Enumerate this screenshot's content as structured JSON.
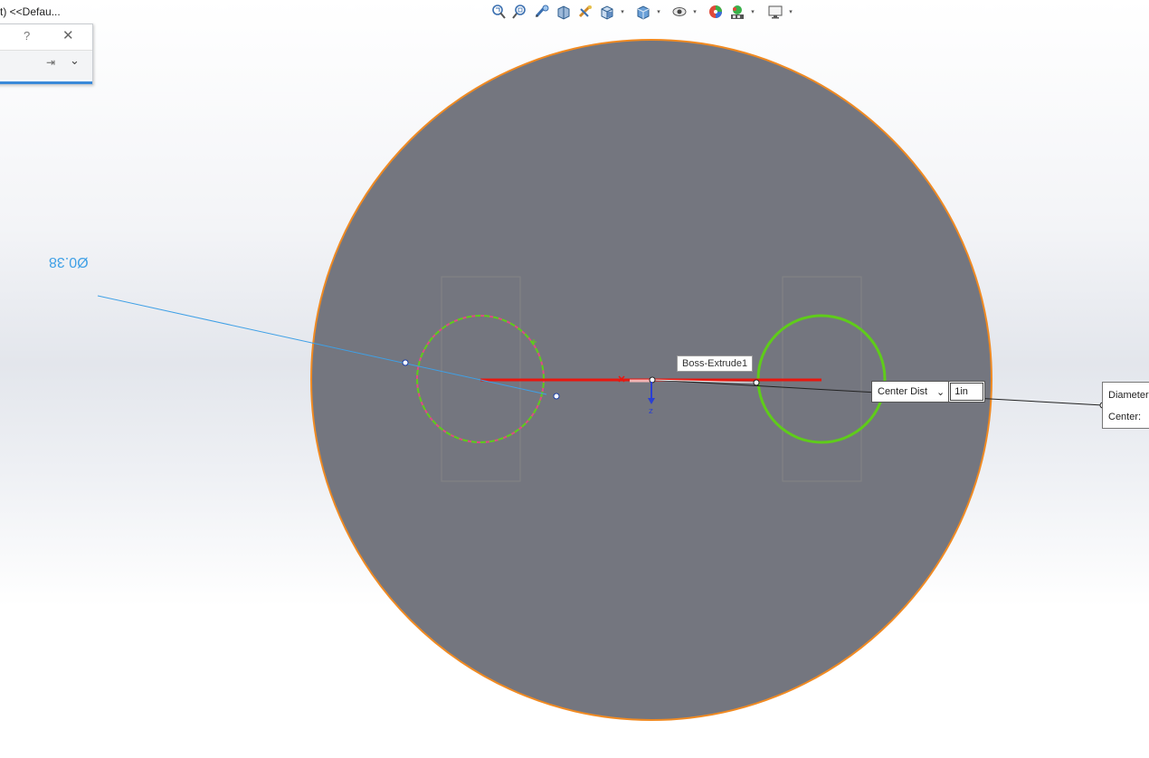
{
  "window": {
    "title_fragment": "t) <<Defau..."
  },
  "panel": {
    "help_label": "?",
    "close_label": "✕",
    "pin_label": "⇥",
    "expand_label": "⌄"
  },
  "toolbar": {
    "items": [
      {
        "icon": "zoom-to-fit-icon"
      },
      {
        "icon": "zoom-to-area-icon"
      },
      {
        "icon": "previous-view-icon"
      },
      {
        "icon": "section-view-icon"
      },
      {
        "icon": "dynamic-annotation-icon"
      },
      {
        "icon": "view-orientation-icon",
        "dropdown": true
      },
      {
        "icon": "display-style-icon",
        "dropdown": true
      },
      {
        "icon": "hide-show-items-icon",
        "dropdown": true
      },
      {
        "icon": "edit-appearance-icon"
      },
      {
        "icon": "apply-scene-icon",
        "dropdown": true
      },
      {
        "icon": "view-settings-icon",
        "dropdown": true
      }
    ],
    "dropdown_glyph": "▾"
  },
  "canvas": {
    "dimension_text": "Ø0.38",
    "boss_tooltip": "Boss-Extrude1",
    "center_dist_label": "Center Dist",
    "center_dist_chevron": "⌄",
    "center_dist_value": "1in",
    "diameter_label": "Diameter",
    "center_label": "Center:",
    "axis_label": "z"
  },
  "colors": {
    "part_face": "#74767f",
    "part_edge": "#f08a22",
    "sketch_green": "#5fcc1a",
    "line_red": "#e8170f",
    "dimension_blue": "#3fa0e6"
  }
}
